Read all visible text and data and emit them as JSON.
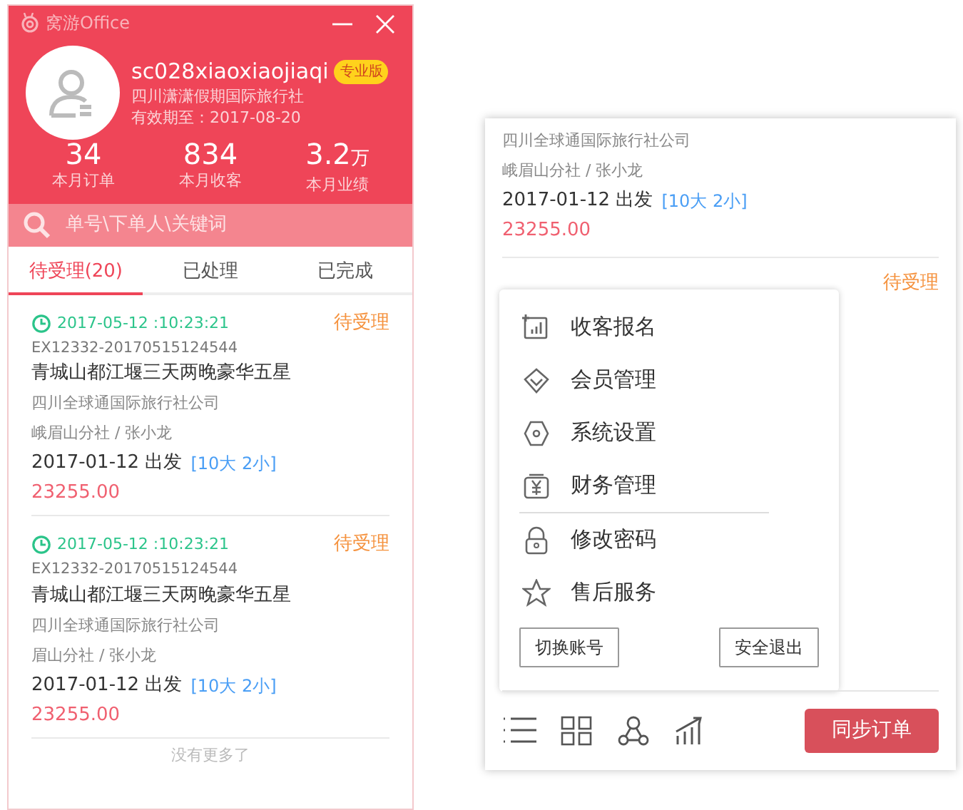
{
  "main_window": {
    "title": "窝游Office",
    "user": {
      "name": "sc028xiaoxiaojiaqi",
      "badge": "专业版",
      "company": "四川潇潇假期国际旅行社",
      "expiry": "有效期至：2017-08-20"
    },
    "stats": [
      {
        "value": "34",
        "label": "本月订单"
      },
      {
        "value": "834",
        "label": "本月收客"
      },
      {
        "value": "3.2",
        "unit": "万",
        "label": "本月业绩"
      }
    ],
    "search": {
      "placeholder": "单号\\下单人\\关键词"
    },
    "tabs": [
      {
        "label": "待受理(20)",
        "selected": true
      },
      {
        "label": "已处理",
        "selected": false
      },
      {
        "label": "已完成",
        "selected": false
      }
    ],
    "orders": [
      {
        "time": "2017-05-12 :10:23:21",
        "order_no": "EX12332-20170515124544",
        "title": "青城山都江堰三天两晚豪华五星",
        "company": "四川全球通国际旅行社公司",
        "branch": "峨眉山分社 / 张小龙",
        "departure": "2017-01-12 出发",
        "people": "[10大  2小]",
        "price": "23255.00",
        "status": "待受理"
      },
      {
        "time": "2017-05-12 :10:23:21",
        "order_no": "EX12332-20170515124544",
        "title": "青城山都江堰三天两晚豪华五星",
        "company": "四川全球通国际旅行社公司",
        "branch": "眉山分社 / 张小龙",
        "departure": "2017-01-12 出发",
        "people": "[10大  2小]",
        "price": "23255.00",
        "status": "待受理"
      }
    ],
    "footer": "没有更多了"
  },
  "menu_window": {
    "order_fragment": {
      "company": "四川全球通国际旅行社公司",
      "branch": "峨眉山分社 / 张小龙",
      "departure": "2017-01-12 出发",
      "people": "[10大  2小]",
      "price": "23255.00"
    },
    "order_status": "待受理",
    "menu": {
      "items": [
        {
          "label": "收客报名",
          "separator_before": false
        },
        {
          "label": "会员管理",
          "separator_before": false
        },
        {
          "label": "系统设置",
          "separator_before": false
        },
        {
          "label": "财务管理",
          "separator_before": false
        },
        {
          "label": "修改密码",
          "separator_before": true
        },
        {
          "label": "售后服务",
          "separator_before": false
        }
      ],
      "buttons": [
        "切换账号",
        "安全退出"
      ]
    },
    "sync_button": "同步订单"
  }
}
